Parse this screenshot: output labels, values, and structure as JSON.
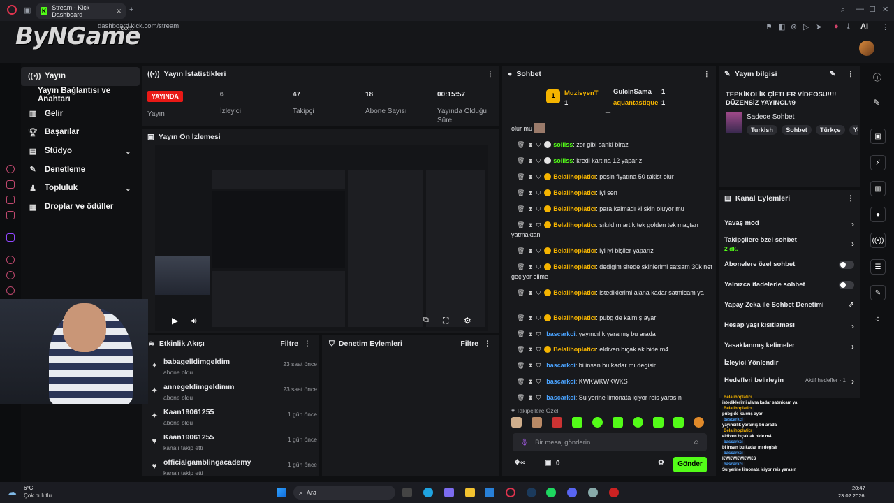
{
  "browser": {
    "tab_title": "Stream - Kick Dashboard",
    "url": "dashboard.kick.com/stream",
    "ai_label": "AI"
  },
  "overlay_logo": "ByNGame",
  "overlay_logo_sub": ".com",
  "nav": {
    "items": [
      {
        "label": "Yayın",
        "icon": "broadcast-icon"
      },
      {
        "label": "Yayın Bağlantısı ve Anahtarı",
        "icon": ""
      },
      {
        "label": "Gelir",
        "icon": "chart-icon"
      },
      {
        "label": "Başarılar",
        "icon": "trophy-icon"
      },
      {
        "label": "Stüdyo",
        "icon": "studio-icon"
      },
      {
        "label": "Denetleme",
        "icon": "wrench-icon"
      },
      {
        "label": "Topluluk",
        "icon": "community-icon"
      },
      {
        "label": "Droplar ve ödüller",
        "icon": "drops-icon"
      }
    ]
  },
  "stats": {
    "title": "Yayın İstatistikleri",
    "live_badge": "YAYINDA",
    "status_label": "Yayın",
    "viewers": "6",
    "viewers_label": "İzleyici",
    "followers": "47",
    "followers_label": "Takipçi",
    "subs": "18",
    "subs_label": "Abone Sayısı",
    "duration": "00:15:57",
    "duration_label": "Yayında Olduğu Süre"
  },
  "preview": {
    "title": "Yayın Ön İzlemesi"
  },
  "activity": {
    "title": "Etkinlik Akışı",
    "filter": "Filtre",
    "rows": [
      {
        "name": "babagelldimgeldim",
        "sub": "abone oldu",
        "time": "23 saat önce",
        "icon": "sparkle-icon"
      },
      {
        "name": "annegeldimgeldimm",
        "sub": "abone oldu",
        "time": "23 saat önce",
        "icon": "sparkle-icon"
      },
      {
        "name": "Kaan19061255",
        "sub": "abone oldu",
        "time": "1 gün önce",
        "icon": "sparkle-icon"
      },
      {
        "name": "Kaan19061255",
        "sub": "kanalı takip etti",
        "time": "1 gün önce",
        "icon": "heart-icon"
      },
      {
        "name": "officialgamblingacademy",
        "sub": "kanalı takip etti",
        "time": "1 gün önce",
        "icon": "heart-icon"
      }
    ]
  },
  "modlog": {
    "title": "Denetim Eylemleri",
    "filter": "Filtre"
  },
  "chat": {
    "title": "Sohbet",
    "top_gifters": [
      {
        "name": "MuzisyenT",
        "count": "1"
      },
      {
        "name": "GulcinSama",
        "count": "1"
      },
      {
        "name": "aquantastique",
        "count": "1"
      }
    ],
    "first_line": "olur mu",
    "messages": [
      {
        "user": "solliss",
        "text": ": zor gibi sanki biraz",
        "color": "g"
      },
      {
        "user": "solliss",
        "text": ": kredi kartına 12 yaparız",
        "color": "g"
      },
      {
        "user": "Belalihoplaticı",
        "text": ": peşin fiyatına 50 takist olur",
        "color": "y"
      },
      {
        "user": "Belalihoplaticı",
        "text": ": iyi sen",
        "color": "y"
      },
      {
        "user": "Belalihoplaticı",
        "text": ": para kalmadı ki skin oluyor mu",
        "color": "y"
      },
      {
        "user": "Belalihoplaticı",
        "text": ": sıkıldım artık tek golden tek maçtan yatmaktan",
        "color": "y"
      },
      {
        "user": "Belalihoplaticı",
        "text": ": iyi iyi bişiler yaparız",
        "color": "y"
      },
      {
        "user": "Belalihoplaticı",
        "text": ": dedigim sitede skinlerimi satsam 30k net geçiyor elime",
        "color": "y"
      },
      {
        "user": "Belalihoplaticı",
        "text": ": istediklerimi alana kadar satmicam ya",
        "color": "y"
      },
      {
        "user": "Belalihoplaticı",
        "text": ": pubg de kalmış ayar",
        "color": "y"
      },
      {
        "user": "bascarkci",
        "text": ": yayıncılık yaramış bu arada",
        "color": "b"
      },
      {
        "user": "Belalihoplaticı",
        "text": ": eldiven bıçak ak bide m4",
        "color": "y"
      },
      {
        "user": "bascarkci",
        "text": ": bi insan bu kadar mı degisir",
        "color": "b"
      },
      {
        "user": "bascarkci",
        "text": ": KWKWKWKWKS",
        "color": "b"
      },
      {
        "user": "bascarkci",
        "text": ": Su yerine limonata içiyor reis yarasın",
        "color": "b"
      }
    ],
    "followers_only": "Takipçilere Özel",
    "input_placeholder": "Bir mesaj gönderin",
    "points": "0",
    "send": "Gönder"
  },
  "stream_info": {
    "title": "Yayın bilgisi",
    "stream_title": "TEPKİKOLİK ÇİFTLER VİDEOSU!!!! DÜZENSİZ YAYINCI.#9",
    "category": "Sadece Sohbet",
    "tags": [
      "Turkish",
      "Sohbet",
      "Türkçe",
      "Yo"
    ]
  },
  "channel_actions": {
    "title": "Kanal Eylemleri",
    "items": [
      {
        "label": "Yavaş mod",
        "kind": "chevron"
      },
      {
        "label": "Takipçilere özel sohbet",
        "sub": "2 dk.",
        "kind": "chevron"
      },
      {
        "label": "Abonelere özel sohbet",
        "kind": "toggle"
      },
      {
        "label": "Yalnızca ifadelerle sohbet",
        "kind": "toggle"
      },
      {
        "label": "Yapay Zeka ile Sohbet Denetimi",
        "kind": "external"
      },
      {
        "label": "Hesap yaşı kısıtlaması",
        "kind": "chevron"
      },
      {
        "label": "Yasaklanmış kelimeler",
        "kind": "chevron"
      },
      {
        "label": "İzleyici Yönlendir",
        "kind": "none"
      },
      {
        "label": "Hedefleri belirleyin",
        "sub_inline": "Aktif hedefler - 1",
        "kind": "chevron"
      }
    ]
  },
  "overlay_chat": [
    {
      "user": "Belalihoplaticı",
      "text": "istediklerimi alana kadar satmicam ya"
    },
    {
      "user": "Belalihoplaticı",
      "text": "pubg de kalmış ayar"
    },
    {
      "user": "bascarkci",
      "text": "yayıncılık yaramış bu arada"
    },
    {
      "user": "Belalihoplaticı",
      "text": "eldiven bıçak ak bide m4"
    },
    {
      "user": "bascarkci",
      "text": "bi insan bu kadar mı degisir"
    },
    {
      "user": "bascarkci",
      "text": "KWKWKWKWKS"
    },
    {
      "user": "bascarkci",
      "text": "Su yerine limonata içiyor reis yarasın"
    }
  ],
  "taskbar": {
    "weather_temp": "6°C",
    "weather_desc": "Çok bulutlu",
    "search": "Ara",
    "time": "20:47",
    "date": "23.02.2026"
  },
  "colors": {
    "kick_green": "#53fc18",
    "live_red": "#e91916",
    "gold": "#f5b400",
    "blue": "#4aa3ff"
  }
}
